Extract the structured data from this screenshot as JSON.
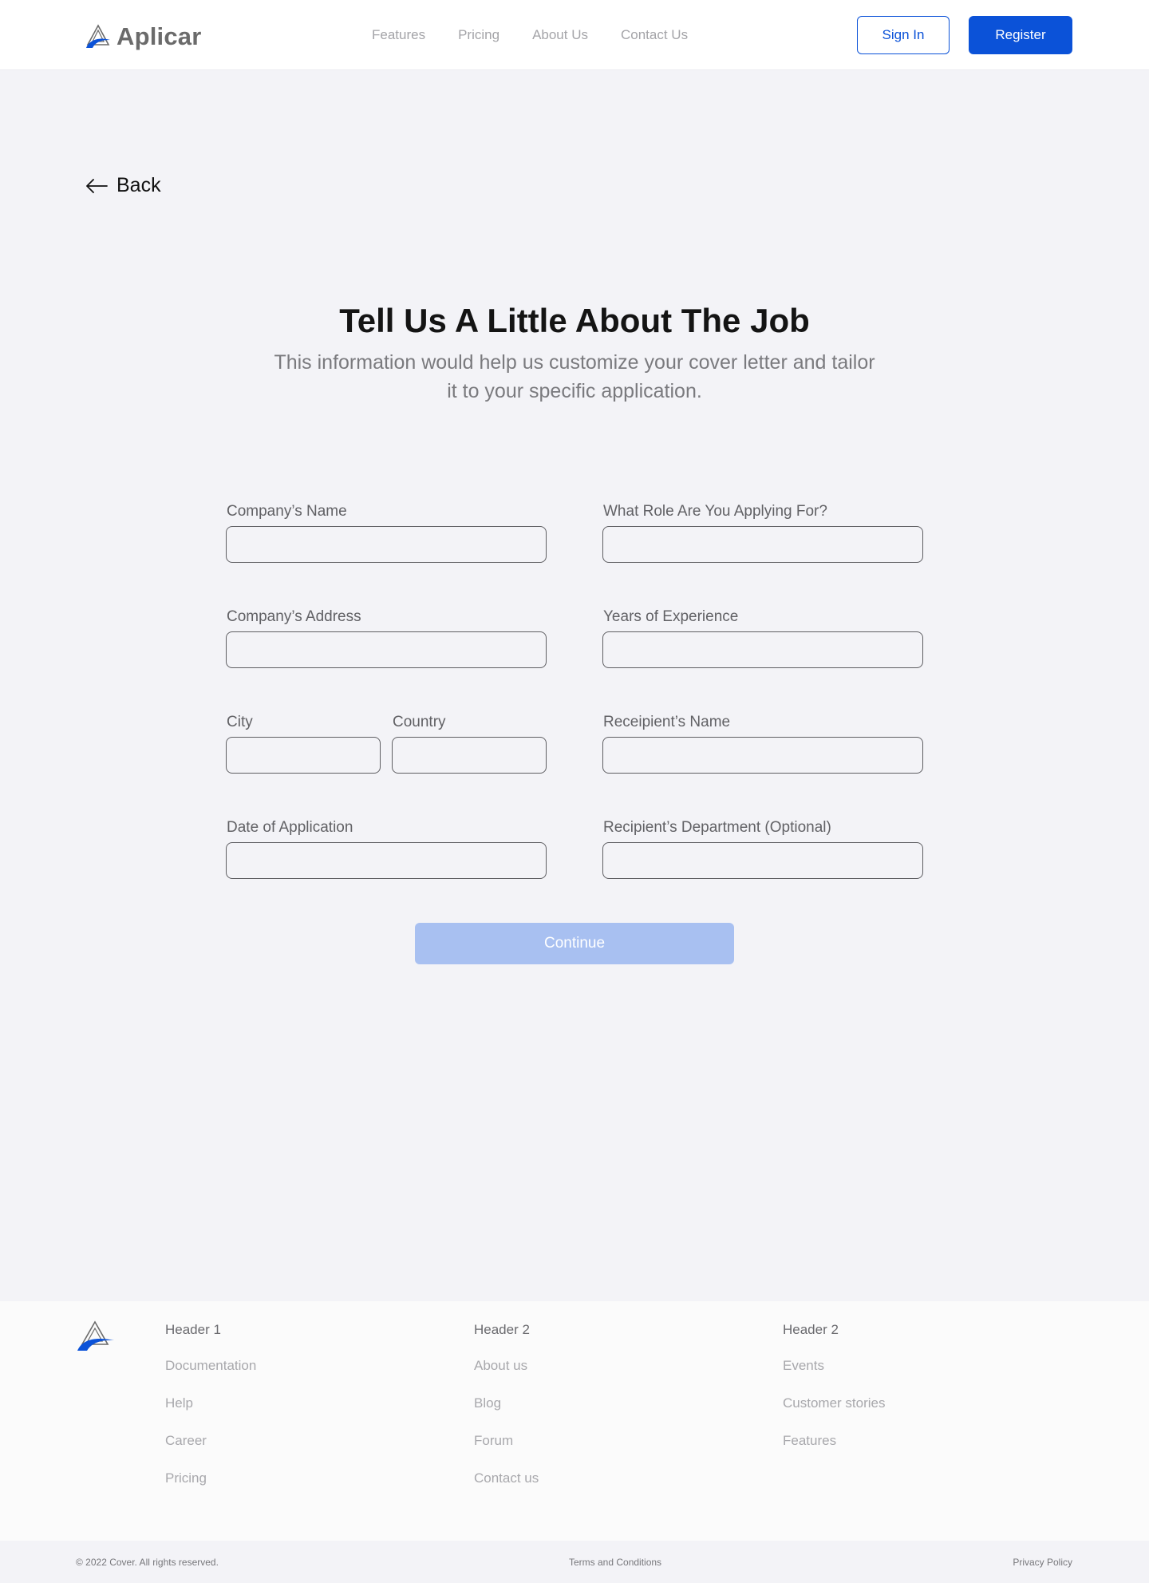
{
  "header": {
    "brand": "Aplicar",
    "nav": [
      "Features",
      "Pricing",
      "About Us",
      "Contact Us"
    ],
    "signin_label": "Sign In",
    "register_label": "Register"
  },
  "back_label": "Back",
  "page": {
    "title": "Tell Us A Little About The Job",
    "subtitle": "This information would help us customize your cover letter and tailor it to your specific application."
  },
  "form": {
    "company_name_label": "Company’s Name",
    "role_label": "What Role Are You Applying For?",
    "company_address_label": "Company’s Address",
    "years_experience_label": "Years of Experience",
    "city_label": "City",
    "country_label": "Country",
    "recipient_name_label": "Receipient’s Name",
    "date_label": "Date of Application",
    "recipient_department_label": "Recipient’s Department (Optional)",
    "continue_label": "Continue"
  },
  "footer": {
    "columns": [
      {
        "header": "Header 1",
        "links": [
          "Documentation",
          "Help",
          "Career",
          "Pricing"
        ]
      },
      {
        "header": "Header 2",
        "links": [
          "About us",
          "Blog",
          "Forum",
          "Contact us"
        ]
      },
      {
        "header": "Header 2",
        "links": [
          "Events",
          "Customer stories",
          "Features"
        ]
      }
    ],
    "copyright": "© 2022 Cover. All rights reserved.",
    "terms": "Terms and Conditions",
    "privacy": "Privacy Policy"
  },
  "colors": {
    "accent": "#0b52d8",
    "continue_disabled": "#a8c0f1",
    "background": "#f3f3f7"
  }
}
